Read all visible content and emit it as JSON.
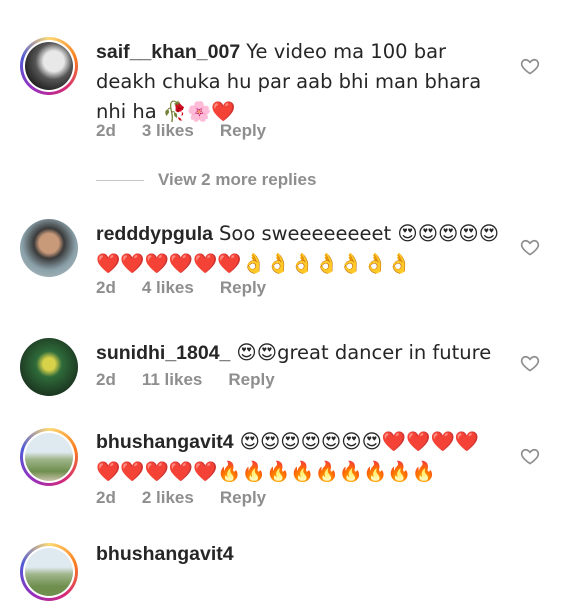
{
  "comments": [
    {
      "username": "saif__khan_007",
      "text": "Ye video ma 100 bar deakh chuka hu par aab bhi man bhara nhi ha 🥀🌸❤️",
      "time": "2d",
      "likes": "3 likes",
      "reply": "Reply"
    },
    {
      "username": "redddypgula",
      "text": "Soo sweeeeeeeet 😍😍😍😍😍❤️❤️❤️❤️❤️❤️👌👌👌👌👌👌👌",
      "time": "2d",
      "likes": "4 likes",
      "reply": "Reply"
    },
    {
      "username": "sunidhi_1804_",
      "text": "😍😍great dancer in future",
      "time": "2d",
      "likes": "11 likes",
      "reply": "Reply"
    },
    {
      "username": "bhushangavit4",
      "text": "😍😍😍😍😍😍😍❤️❤️❤️❤️❤️❤️❤️❤️❤️🔥🔥🔥🔥🔥🔥🔥🔥🔥",
      "time": "2d",
      "likes": "2 likes",
      "reply": "Reply"
    },
    {
      "username": "bhushangavit4"
    }
  ],
  "view_replies": "View 2 more replies",
  "icons": {
    "like": "heart-outline-icon"
  },
  "colors": {
    "secondary_text": "#8e8e8e",
    "primary_text": "#262626"
  }
}
